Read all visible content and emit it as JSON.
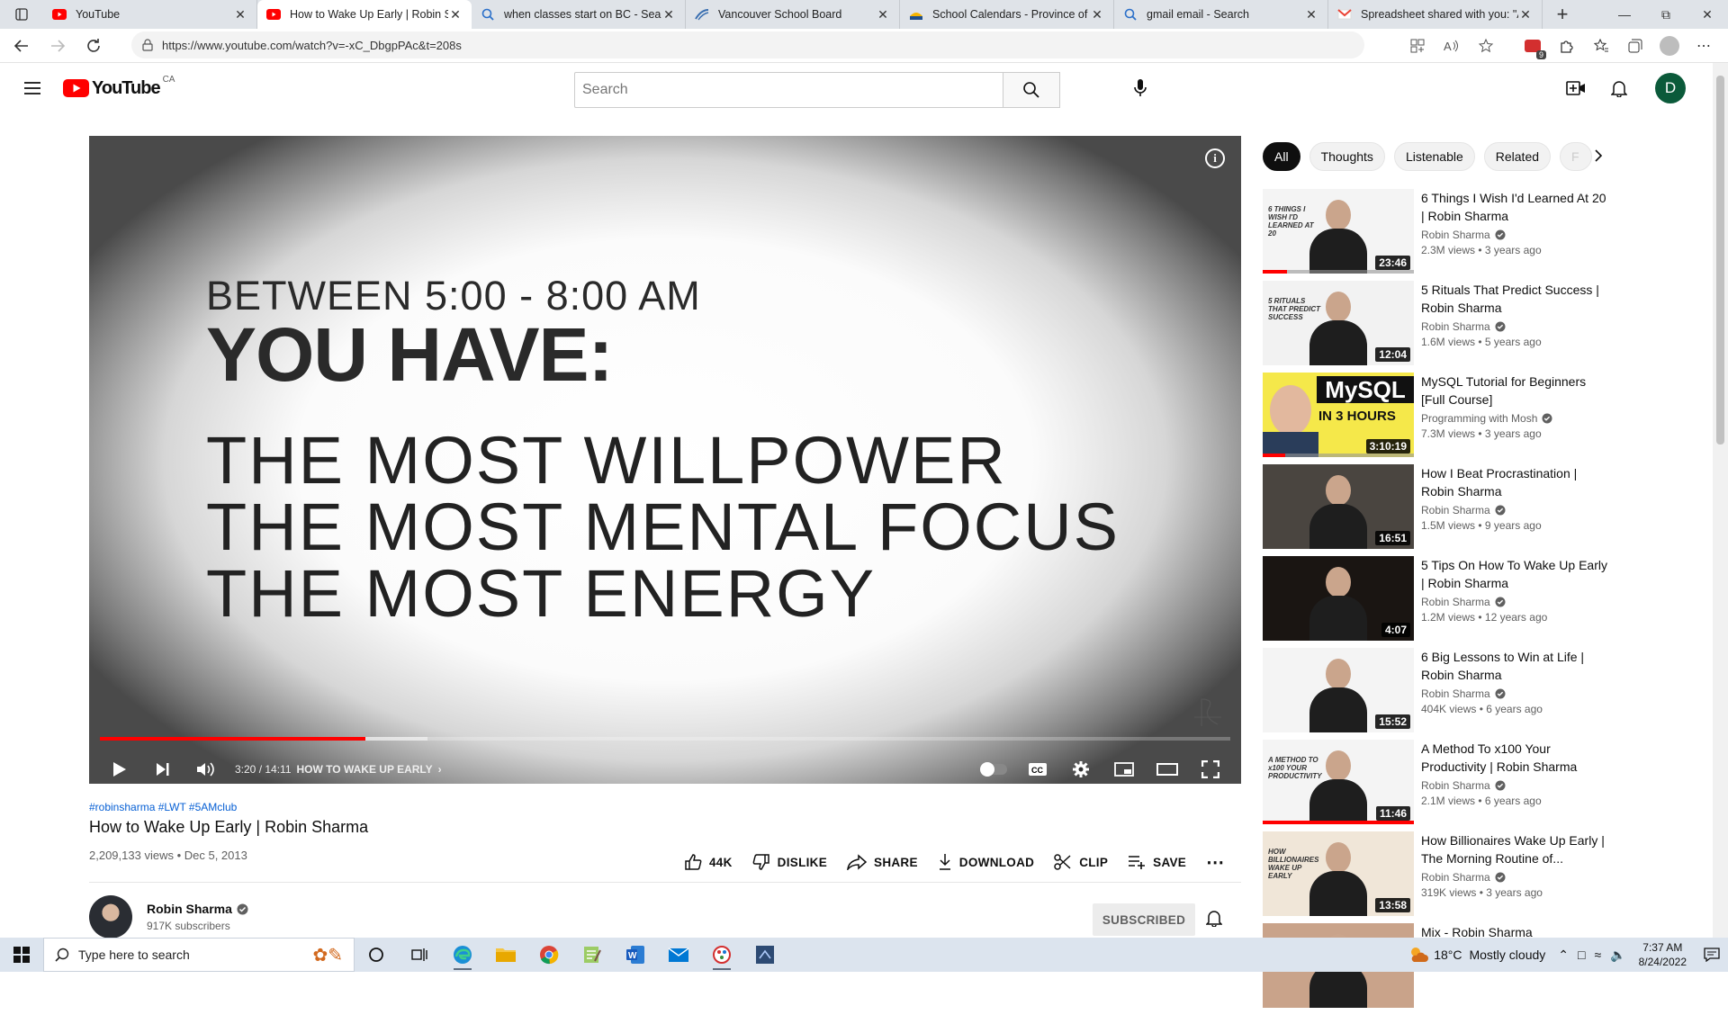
{
  "browser": {
    "tabs": [
      {
        "title": "YouTube",
        "icon": "youtube-icon",
        "active": false
      },
      {
        "title": "How to Wake Up Early | Robin Sharma",
        "icon": "youtube-icon",
        "active": true
      },
      {
        "title": "when classes start on BC - Search",
        "icon": "search-icon",
        "active": false
      },
      {
        "title": "Vancouver School Board",
        "icon": "vsb-icon",
        "active": false
      },
      {
        "title": "School Calendars - Province of BC",
        "icon": "bc-icon",
        "active": false
      },
      {
        "title": "gmail email - Search",
        "icon": "search-icon",
        "active": false
      },
      {
        "title": "Spreadsheet shared with you: \"A",
        "icon": "gmail-icon",
        "active": false
      }
    ],
    "url": "https://www.youtube.com/watch?v=-xC_DbgpPAc&t=208s",
    "extension_badge": "9"
  },
  "header": {
    "logo_text": "YouTube",
    "country": "CA",
    "search_placeholder": "Search",
    "avatar_letter": "D"
  },
  "video": {
    "lines": [
      "BETWEEN 5:00 - 8:00 AM",
      "YOU HAVE:",
      "THE MOST WILLPOWER",
      "THE MOST MENTAL FOCUS",
      "THE MOST ENERGY"
    ],
    "time": "3:20 / 14:11",
    "chapter": "HOW TO WAKE UP EARLY",
    "progress_fraction": 0.235,
    "buffered_fraction": 0.29,
    "tags": "#robinsharma #LWT #5AMclub",
    "title": "How to Wake Up Early | Robin Sharma",
    "views": "2,209,133 views",
    "date": "Dec 5, 2013",
    "meta_sep": " • "
  },
  "actions": {
    "likes": "44K",
    "dislike": "DISLIKE",
    "share": "SHARE",
    "download": "DOWNLOAD",
    "clip": "CLIP",
    "save": "SAVE"
  },
  "channel": {
    "name": "Robin Sharma",
    "subscribers": "917K subscribers",
    "subscribed_label": "SUBSCRIBED"
  },
  "chips": [
    "All",
    "Thoughts",
    "Listenable",
    "Related",
    "F"
  ],
  "recommendations": [
    {
      "title": "6 Things I Wish I'd Learned At 20 | Robin Sharma",
      "channel": "Robin Sharma",
      "verified": true,
      "views": "2.3M views",
      "age": "3 years ago",
      "duration": "23:46",
      "watched": 0.16,
      "thumb_text": "6 THINGS I WISH I'D LEARNED AT 20",
      "thumb_bg": "#f4f4f4"
    },
    {
      "title": "5 Rituals That Predict Success | Robin Sharma",
      "channel": "Robin Sharma",
      "verified": true,
      "views": "1.6M views",
      "age": "5 years ago",
      "duration": "12:04",
      "watched": 0,
      "thumb_text": "5 RITUALS THAT PREDICT SUCCESS",
      "thumb_bg": "#f2f2f2"
    },
    {
      "title": "MySQL Tutorial for Beginners [Full Course]",
      "channel": "Programming with Mosh",
      "verified": true,
      "views": "7.3M views",
      "age": "3 years ago",
      "duration": "3:10:19",
      "watched": 0.15,
      "thumb_text": "MySQL|IN 3 HOURS",
      "thumb_bg": "#f5e84a"
    },
    {
      "title": "How I Beat Procrastination | Robin Sharma",
      "channel": "Robin Sharma",
      "verified": true,
      "views": "1.5M views",
      "age": "9 years ago",
      "duration": "16:51",
      "watched": 0,
      "thumb_text": "",
      "thumb_bg": "#4a4540"
    },
    {
      "title": "5 Tips On How To Wake Up Early | Robin Sharma",
      "channel": "Robin Sharma",
      "verified": true,
      "views": "1.2M views",
      "age": "12 years ago",
      "duration": "4:07",
      "watched": 0,
      "thumb_text": "",
      "thumb_bg": "#1a1512"
    },
    {
      "title": "6 Big Lessons to Win at Life | Robin Sharma",
      "channel": "Robin Sharma",
      "verified": true,
      "views": "404K views",
      "age": "6 years ago",
      "duration": "15:52",
      "watched": 0,
      "thumb_text": "",
      "thumb_bg": "#f4f4f4"
    },
    {
      "title": "A Method To x100 Your Productivity | Robin Sharma",
      "channel": "Robin Sharma",
      "verified": true,
      "views": "2.1M views",
      "age": "6 years ago",
      "duration": "11:46",
      "watched": 1.0,
      "thumb_text": "A METHOD TO x100 YOUR PRODUCTIVITY",
      "thumb_bg": "#f4f4f4"
    },
    {
      "title": "How Billionaires Wake Up Early | The Morning Routine of...",
      "channel": "Robin Sharma",
      "verified": true,
      "views": "319K views",
      "age": "3 years ago",
      "duration": "13:58",
      "watched": 0,
      "thumb_text": "HOW BILLIONAIRES WAKE UP EARLY",
      "thumb_bg": "#f0e6d8"
    },
    {
      "title": "Mix - Robin Sharma",
      "channel": "",
      "verified": false,
      "views": "",
      "age": "",
      "duration": "",
      "watched": 0,
      "thumb_text": "",
      "thumb_bg": "#c9a38a"
    }
  ],
  "taskbar": {
    "search_placeholder": "Type here to search",
    "temperature": "18°C",
    "weather": "Mostly cloudy",
    "time": "7:37 AM",
    "date": "8/24/2022"
  },
  "colors": {
    "accent": "#ff0000",
    "link": "#065fd4",
    "avatar_bg": "#0b5a3a"
  }
}
